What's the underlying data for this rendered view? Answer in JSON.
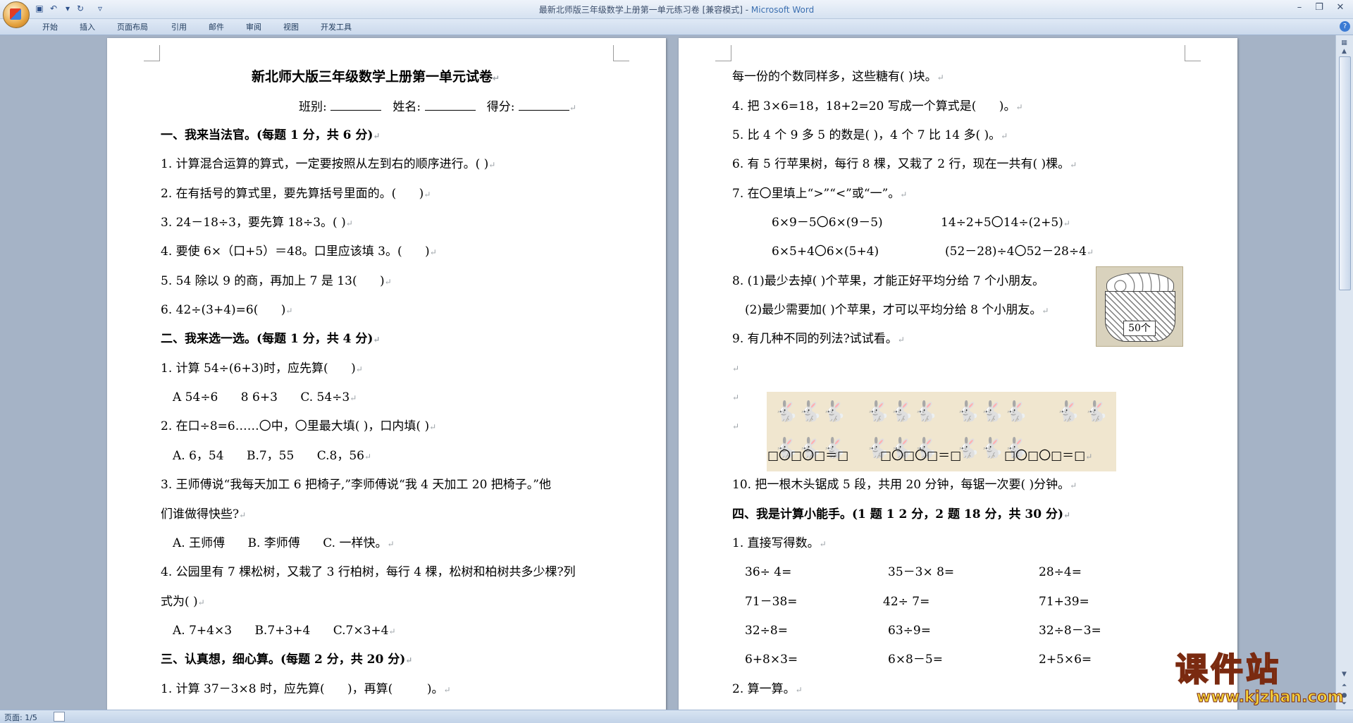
{
  "window": {
    "title": "最新北师版三年级数学上册第一单元练习卷 [兼容模式] - ",
    "app_name": "Microsoft Word",
    "quick_access": [
      "save-icon",
      "undo-icon",
      "redo-icon",
      "customize-icon"
    ]
  },
  "ribbon": {
    "tabs": [
      "开始",
      "插入",
      "页面布局",
      "引用",
      "邮件",
      "审阅",
      "视图",
      "开发工具"
    ],
    "help": "?"
  },
  "status": {
    "page": "页面: 1/5"
  },
  "left_page": {
    "title": "新北师大版三年级数学上册第一单元试卷",
    "info": {
      "class_label": "班别:",
      "name_label": "姓名:",
      "score_label": "得分:"
    },
    "s1": "一、我来当法官。(每题 1 分，共 6 分)",
    "s1_q1": "1. 计算混合运算的算式，一定要按照从左到右的顺序进行。( )",
    "s1_q2": "2. 在有括号的算式里，要先算括号里面的。(      )",
    "s1_q3": "3. 24－18÷3，要先算 18÷3。( )",
    "s1_q4": "4. 要使 6×（口+5）＝48。口里应该填 3。(      )",
    "s1_q5": "5. 54 除以 9 的商，再加上 7 是 13(      )",
    "s1_q6": "6. 42÷(3+4)=6(      )",
    "s2": "二、我来选一选。(每题 1 分，共 4 分)",
    "s2_q1": "1. 计算 54÷(6+3)时，应先算(      )",
    "s2_q1_opts": "A 54÷6      8 6+3      C. 54÷3",
    "s2_q2": "2. 在口÷8=6……〇中，〇里最大填( )，口内填( )",
    "s2_q2_opts": "A. 6，54      B.7，55      C.8，56",
    "s2_q3a": "3. 王师傅说“我每天加工 6 把椅子,”李师傅说“我 4 天加工 20 把椅子。”他",
    "s2_q3b": "们谁做得快些?",
    "s2_q3_opts": "A. 王师傅      B. 李师傅      C. 一样快。",
    "s2_q4a": "4. 公园里有 7 棵松树，又栽了 3 行柏树，每行 4 棵，松树和柏树共多少棵?列",
    "s2_q4b": "式为( )",
    "s2_q4_opts": "A. 7+4×3      B.7+3+4      C.7×3+4",
    "s3": "三、认真想，细心算。(每题 2 分，共 20 分)",
    "s3_q1": "1. 计算 37－3×8 时，应先算(      )，再算(         )。"
  },
  "right_page": {
    "l1": "每一份的个数同样多，这些糖有( )块。",
    "q4": "4. 把 3×6=18，18+2=20 写成一个算式是(      )。",
    "q5": "5. 比 4 个 9 多 5 的数是( )，4 个 7 比 14 多( )。",
    "q6": "6. 有 5 行苹果树，每行 8 棵，又栽了 2 行，现在一共有( )棵。",
    "q7": "7. 在〇里填上“>”“<”或“一”。",
    "q7_a": "6×9－5〇6×(9－5)",
    "q7_b": "14÷2+5〇14÷(2+5)",
    "q7_c": "6×5+4〇6×(5+4)",
    "q7_d": "(52－28)÷4〇52－28÷4",
    "q8a": "8. (1)最少去掉( )个苹果，才能正好平均分给 7 个小朋友。",
    "q8b": "(2)最少需要加( )个苹果，才可以平均分给 8 个小朋友。",
    "basket_label": "50个",
    "q9": "9. 有几种不同的列法?试试看。",
    "q9_eq1": "□〇□〇□＝□",
    "q9_eq2": "□〇□〇□＝□",
    "q9_eq3": "□〇□〇□＝□",
    "q10": "10. 把一根木头锯成 5 段，共用 20 分钟，每锯一次要( )分钟。",
    "s4": "四、我是计算小能手。(1 题 1 2 分，2 题 18 分，共 30 分)",
    "s4_q1": "1. 直接写得数。",
    "calc": [
      [
        "36÷ 4=",
        "35－3× 8=",
        "28÷4="
      ],
      [
        "71－38=",
        "42÷ 7=",
        "71+39="
      ],
      [
        "32÷8=",
        "63÷9=",
        "32÷8－3="
      ],
      [
        "6+8×3=",
        "6×8－5=",
        "2+5×6="
      ]
    ],
    "s4_q2": "2. 算一算。"
  },
  "watermark": {
    "big": "课件站",
    "url": "www.kjzhan.com"
  }
}
